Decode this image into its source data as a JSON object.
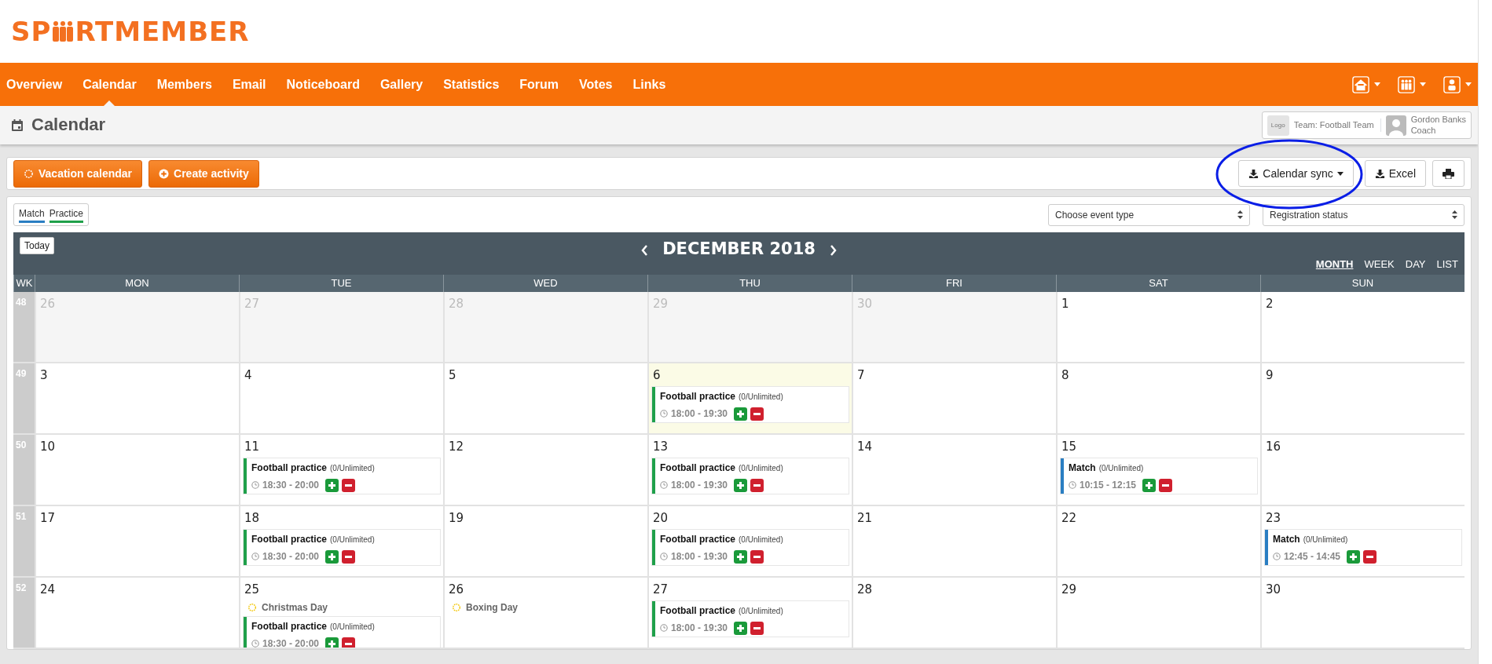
{
  "logo": {
    "before": "SP",
    "after": "RTMEMBER"
  },
  "nav": [
    {
      "label": "Overview",
      "selected": false
    },
    {
      "label": "Calendar",
      "selected": true
    },
    {
      "label": "Members",
      "selected": false
    },
    {
      "label": "Email",
      "selected": false
    },
    {
      "label": "Noticeboard",
      "selected": false
    },
    {
      "label": "Gallery",
      "selected": false
    },
    {
      "label": "Statistics",
      "selected": false
    },
    {
      "label": "Forum",
      "selected": false
    },
    {
      "label": "Votes",
      "selected": false
    },
    {
      "label": "Links",
      "selected": false
    }
  ],
  "nav_menus": [
    {
      "kind": "home"
    },
    {
      "kind": "team"
    },
    {
      "kind": "user"
    }
  ],
  "page_title": "Calendar",
  "context": {
    "logo_text": "Logo",
    "team": "Team: Football Team",
    "user_name": "Gordon Banks",
    "user_role": "Coach"
  },
  "toolbar_left": [
    {
      "kind": "vacation",
      "label": "Vacation calendar"
    },
    {
      "kind": "create",
      "label": "Create activity"
    }
  ],
  "toolbar_right": [
    {
      "kind": "sync",
      "label": "Calendar sync",
      "dropdown": true,
      "highlighted": true
    },
    {
      "kind": "excel",
      "label": "Excel"
    },
    {
      "kind": "print"
    }
  ],
  "legend": [
    {
      "label": "Match",
      "color": "#2a7ec2"
    },
    {
      "label": "Practice",
      "color": "#1fa04a"
    }
  ],
  "filters": [
    {
      "value": "Choose event type"
    },
    {
      "value": "Registration status"
    }
  ],
  "calendar": {
    "today_button": "Today",
    "title": "DECEMBER 2018",
    "views": [
      {
        "label": "MONTH",
        "selected": true
      },
      {
        "label": "WEEK",
        "selected": false
      },
      {
        "label": "DAY",
        "selected": false
      },
      {
        "label": "LIST",
        "selected": false
      }
    ],
    "wk_label": "WK",
    "weekdays": [
      "MON",
      "TUE",
      "WED",
      "THU",
      "FRI",
      "SAT",
      "SUN"
    ],
    "weeks": [
      {
        "number": "48",
        "days": [
          {
            "date": "26",
            "other_month": true,
            "today": false
          },
          {
            "date": "27",
            "other_month": true,
            "today": false
          },
          {
            "date": "28",
            "other_month": true,
            "today": false
          },
          {
            "date": "29",
            "other_month": true,
            "today": false
          },
          {
            "date": "30",
            "other_month": true,
            "today": false
          },
          {
            "date": "1",
            "other_month": false,
            "today": false
          },
          {
            "date": "2",
            "other_month": false,
            "today": false
          }
        ]
      },
      {
        "number": "49",
        "days": [
          {
            "date": "3",
            "other_month": false,
            "today": false
          },
          {
            "date": "4",
            "other_month": false,
            "today": false
          },
          {
            "date": "5",
            "other_month": false,
            "today": false
          },
          {
            "date": "6",
            "other_month": false,
            "today": true,
            "events": [
              {
                "kind": "activity",
                "title": "Football practice",
                "capacity": "(0/Unlimited)",
                "time": "18:00 - 19:30",
                "color": "#1fa04a"
              }
            ]
          },
          {
            "date": "7",
            "other_month": false,
            "today": false
          },
          {
            "date": "8",
            "other_month": false,
            "today": false
          },
          {
            "date": "9",
            "other_month": false,
            "today": false
          }
        ]
      },
      {
        "number": "50",
        "days": [
          {
            "date": "10",
            "other_month": false,
            "today": false
          },
          {
            "date": "11",
            "other_month": false,
            "today": false,
            "events": [
              {
                "kind": "activity",
                "title": "Football practice",
                "capacity": "(0/Unlimited)",
                "time": "18:30 - 20:00",
                "color": "#1fa04a"
              }
            ]
          },
          {
            "date": "12",
            "other_month": false,
            "today": false
          },
          {
            "date": "13",
            "other_month": false,
            "today": false,
            "events": [
              {
                "kind": "activity",
                "title": "Football practice",
                "capacity": "(0/Unlimited)",
                "time": "18:00 - 19:30",
                "color": "#1fa04a"
              }
            ]
          },
          {
            "date": "14",
            "other_month": false,
            "today": false
          },
          {
            "date": "15",
            "other_month": false,
            "today": false,
            "events": [
              {
                "kind": "activity",
                "title": "Match",
                "capacity": "(0/Unlimited)",
                "time": "10:15 - 12:15",
                "color": "#2a7ec2"
              }
            ]
          },
          {
            "date": "16",
            "other_month": false,
            "today": false
          }
        ]
      },
      {
        "number": "51",
        "days": [
          {
            "date": "17",
            "other_month": false,
            "today": false
          },
          {
            "date": "18",
            "other_month": false,
            "today": false,
            "events": [
              {
                "kind": "activity",
                "title": "Football practice",
                "capacity": "(0/Unlimited)",
                "time": "18:30 - 20:00",
                "color": "#1fa04a"
              }
            ]
          },
          {
            "date": "19",
            "other_month": false,
            "today": false
          },
          {
            "date": "20",
            "other_month": false,
            "today": false,
            "events": [
              {
                "kind": "activity",
                "title": "Football practice",
                "capacity": "(0/Unlimited)",
                "time": "18:00 - 19:30",
                "color": "#1fa04a"
              }
            ]
          },
          {
            "date": "21",
            "other_month": false,
            "today": false
          },
          {
            "date": "22",
            "other_month": false,
            "today": false
          },
          {
            "date": "23",
            "other_month": false,
            "today": false,
            "events": [
              {
                "kind": "activity",
                "title": "Match",
                "capacity": "(0/Unlimited)",
                "time": "12:45 - 14:45",
                "color": "#2a7ec2"
              }
            ]
          }
        ]
      },
      {
        "number": "52",
        "days": [
          {
            "date": "24",
            "other_month": false,
            "today": false
          },
          {
            "date": "25",
            "other_month": false,
            "today": false,
            "events": [
              {
                "kind": "holiday",
                "title": "Christmas Day"
              },
              {
                "kind": "activity",
                "title": "Football practice",
                "capacity": "(0/Unlimited)",
                "time": "18:30 - 20:00",
                "color": "#1fa04a"
              }
            ]
          },
          {
            "date": "26",
            "other_month": false,
            "today": false,
            "events": [
              {
                "kind": "holiday",
                "title": "Boxing Day"
              }
            ]
          },
          {
            "date": "27",
            "other_month": false,
            "today": false,
            "events": [
              {
                "kind": "activity",
                "title": "Football practice",
                "capacity": "(0/Unlimited)",
                "time": "18:00 - 19:30",
                "color": "#1fa04a"
              }
            ]
          },
          {
            "date": "28",
            "other_month": false,
            "today": false
          },
          {
            "date": "29",
            "other_month": false,
            "today": false
          },
          {
            "date": "30",
            "other_month": false,
            "today": false
          }
        ]
      }
    ]
  }
}
